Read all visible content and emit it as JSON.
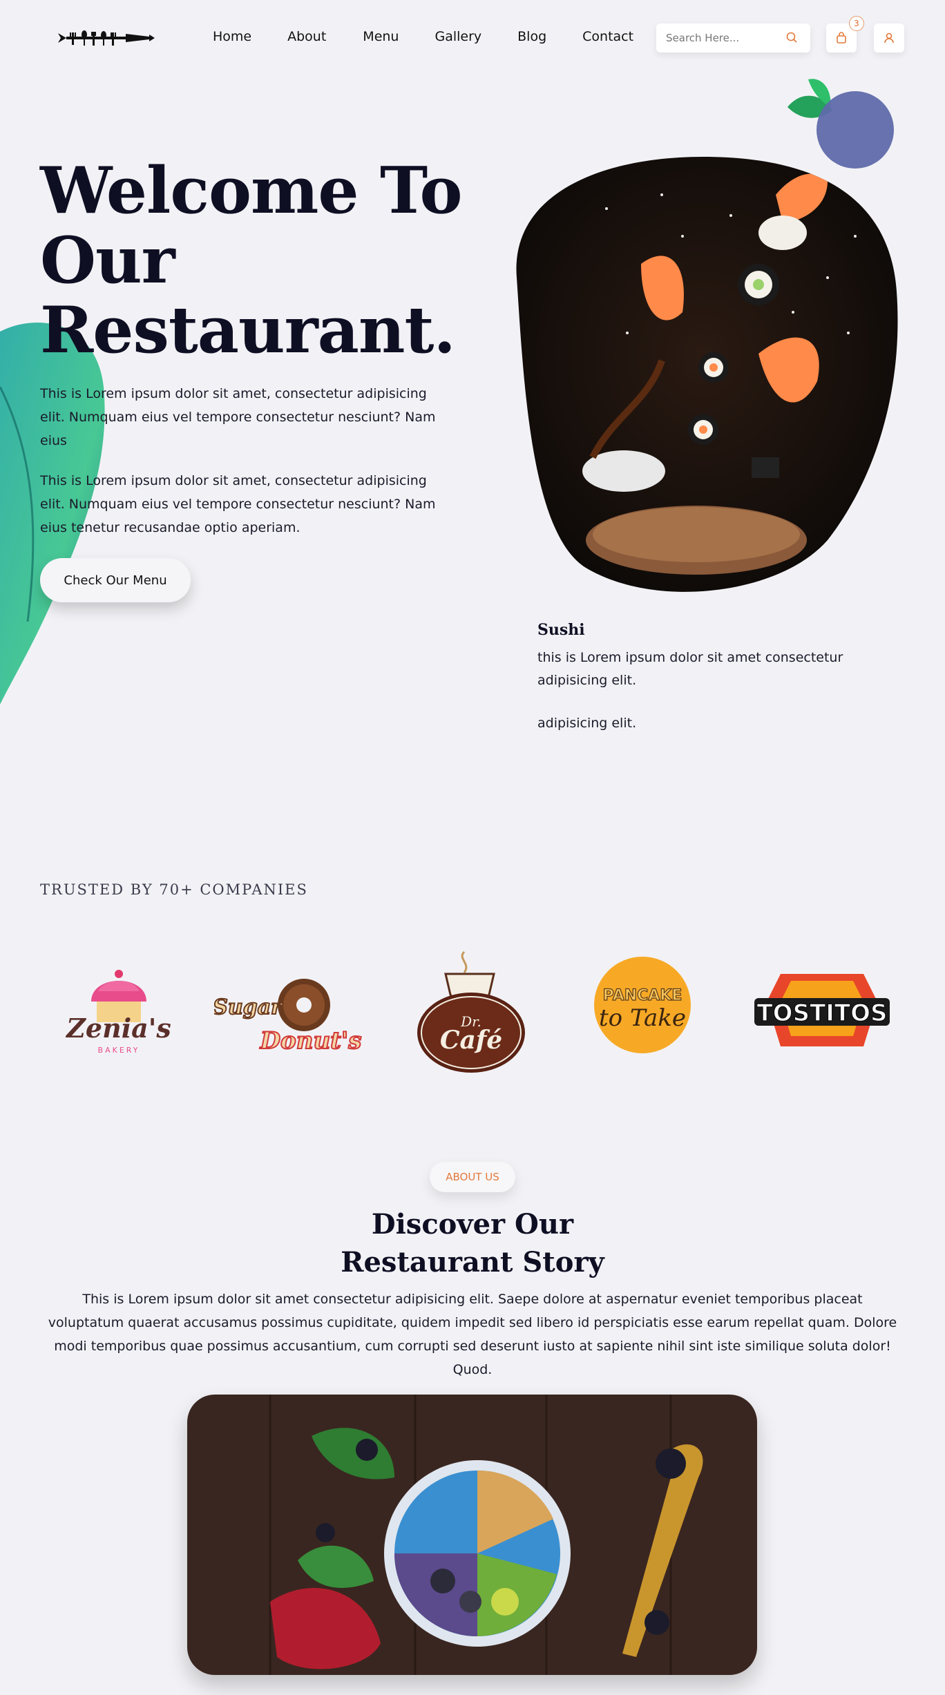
{
  "nav": {
    "links": [
      "Home",
      "About",
      "Menu",
      "Gallery",
      "Blog",
      "Contact"
    ],
    "search_placeholder": "Search Here...",
    "cart_count": "3",
    "icons": [
      "search-icon",
      "cart-icon",
      "user-icon"
    ]
  },
  "hero": {
    "title_lines": [
      "Welcome To",
      "Our",
      "Restaurant."
    ],
    "paragraph_1": "This is Lorem ipsum dolor sit amet, consectetur adipisicing elit. Numquam eius vel tempore consectetur nesciunt? Nam eius",
    "paragraph_2": "This is Lorem ipsum dolor sit amet, consectetur adipisicing elit. Numquam eius vel tempore consectetur nesciunt? Nam eius tenetur recusandae optio aperiam.",
    "cta": "Check Our Menu"
  },
  "featured": {
    "name": "Sushi",
    "description": "this is Lorem ipsum dolor sit amet consectetur adipisicing elit.",
    "extra": "adipisicing elit."
  },
  "trusted": {
    "heading": "TRUSTED BY 70+ COMPANIES",
    "brands": [
      {
        "name": "Zenia's",
        "sub": "BAKERY"
      },
      {
        "name": "Sugar",
        "sub": "Donut's"
      },
      {
        "name": "Dr.",
        "sub": "Café"
      },
      {
        "name": "PANCAKE",
        "sub": "to Take"
      },
      {
        "name": "TOSTITOS",
        "sub": ""
      }
    ]
  },
  "about": {
    "pill": "ABOUT US",
    "title_lines": [
      "Discover Our",
      "Restaurant Story"
    ],
    "paragraph": "This is Lorem ipsum dolor sit amet consectetur adipisicing elit. Saepe dolore at aspernatur eveniet temporibus placeat voluptatum quaerat accusamus possimus cupiditate, quidem impedit sed libero id perspiciatis esse earum repellat quam. Dolore modi temporibus quae possimus accusantium, cum corrupti sed deserunt iusto at sapiente nihil sint iste similique soluta dolor! Quod."
  },
  "colors": {
    "background": "#f2f2f6",
    "heading": "#0f0f24",
    "accent": "#e2793a"
  }
}
